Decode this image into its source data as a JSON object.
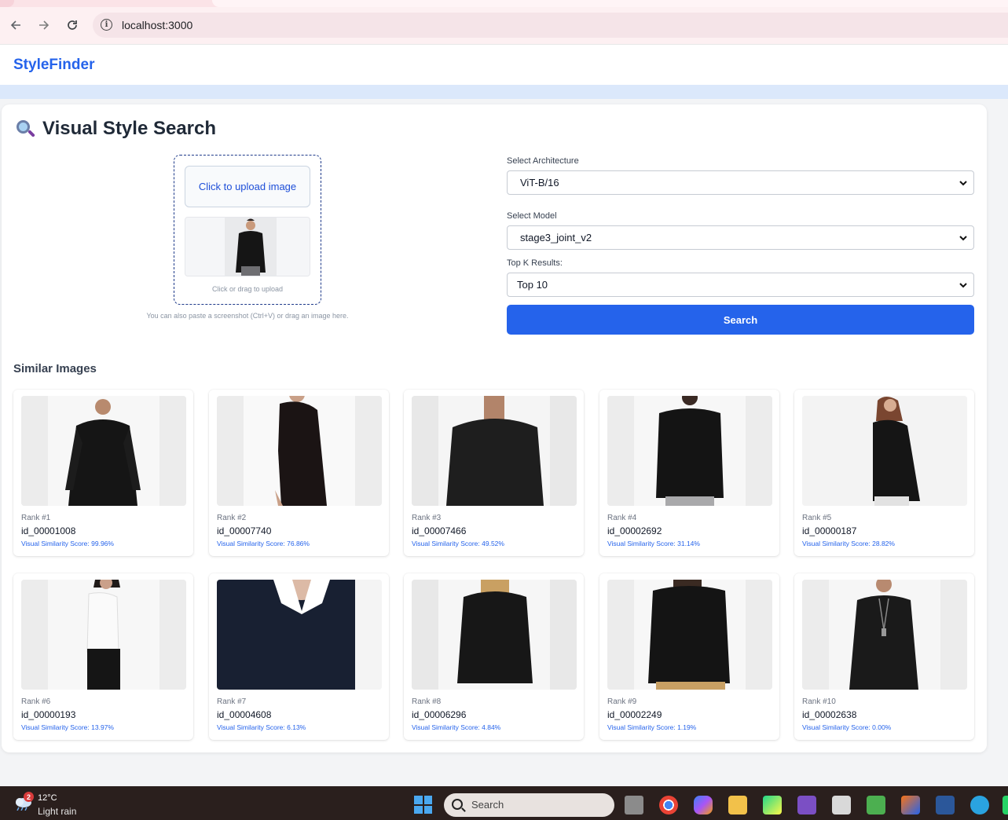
{
  "browser": {
    "url": "localhost:3000",
    "back_icon": "arrow-left-icon",
    "forward_icon": "arrow-right-icon",
    "reload_icon": "reload-icon"
  },
  "app": {
    "brand": "StyleFinder",
    "page_title": "Visual Style Search",
    "title_icon": "magnifier-icon"
  },
  "upload": {
    "button_label": "Click to upload image",
    "hint": "Click or drag to upload",
    "paste_hint": "You can also paste a screenshot (Ctrl+V) or drag an image here."
  },
  "form": {
    "architecture_label": "Select Architecture",
    "architecture_value": "ViT-B/16",
    "model_label": "Select Model",
    "model_value": "stage3_joint_v2",
    "topk_label": "Top K Results:",
    "topk_value": "Top 10",
    "search_label": "Search"
  },
  "results": {
    "title": "Similar Images",
    "items": [
      {
        "rank": "Rank #1",
        "id": "id_00001008",
        "score": "Visual Similarity Score: 99.96%"
      },
      {
        "rank": "Rank #2",
        "id": "id_00007740",
        "score": "Visual Similarity Score: 76.86%"
      },
      {
        "rank": "Rank #3",
        "id": "id_00007466",
        "score": "Visual Similarity Score: 49.52%"
      },
      {
        "rank": "Rank #4",
        "id": "id_00002692",
        "score": "Visual Similarity Score: 31.14%"
      },
      {
        "rank": "Rank #5",
        "id": "id_00000187",
        "score": "Visual Similarity Score: 28.82%"
      },
      {
        "rank": "Rank #6",
        "id": "id_00000193",
        "score": "Visual Similarity Score: 13.97%"
      },
      {
        "rank": "Rank #7",
        "id": "id_00004608",
        "score": "Visual Similarity Score: 6.13%"
      },
      {
        "rank": "Rank #8",
        "id": "id_00006296",
        "score": "Visual Similarity Score: 4.84%"
      },
      {
        "rank": "Rank #9",
        "id": "id_00002249",
        "score": "Visual Similarity Score: 1.19%"
      },
      {
        "rank": "Rank #10",
        "id": "id_00002638",
        "score": "Visual Similarity Score: 0.00%"
      }
    ]
  },
  "taskbar": {
    "weather_badge": "2",
    "temperature": "12°C",
    "condition": "Light rain",
    "search_placeholder": "Search"
  }
}
